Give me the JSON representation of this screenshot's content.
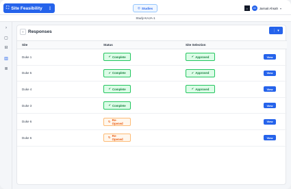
{
  "app": {
    "brand_label": "Site Feasibility",
    "brand_more": "⋮",
    "studies_label": "Studies",
    "user_name": "Jarnait Ahsah",
    "user_initials": "JA",
    "org_logo": "⌂"
  },
  "study_label": "Study-KAJA-1",
  "sidebar": {
    "items": [
      {
        "icon": "chevron-right-icon",
        "glyph": "›"
      },
      {
        "icon": "document-icon",
        "glyph": "▢"
      },
      {
        "icon": "inbox-icon",
        "glyph": "⊟"
      },
      {
        "icon": "chart-icon",
        "glyph": "▥"
      },
      {
        "icon": "file-text-icon",
        "glyph": "≣"
      }
    ]
  },
  "panel": {
    "title": "Responses",
    "back_glyph": "‹",
    "menu_glyph": "⋮",
    "menu_caret": "▾"
  },
  "table": {
    "headers": [
      "Site",
      "Status",
      "Site Selection",
      ""
    ],
    "rows": [
      {
        "site": "Duke 1",
        "status": "Complete",
        "status_type": "complete",
        "selection": "Approved",
        "action": "View"
      },
      {
        "site": "Duke 5",
        "status": "Complete",
        "status_type": "complete",
        "selection": "Approved",
        "action": "View"
      },
      {
        "site": "Duke 4",
        "status": "Complete",
        "status_type": "complete",
        "selection": "Approved",
        "action": "View"
      },
      {
        "site": "Duke 3",
        "status": "Complete",
        "status_type": "complete",
        "selection": "",
        "action": "View"
      },
      {
        "site": "Duke 6",
        "status": "Re-Opened",
        "status_type": "reopened",
        "selection": "",
        "action": "View"
      },
      {
        "site": "Duke 6",
        "status": "Re-Opened",
        "status_type": "reopened",
        "selection": "",
        "action": "View"
      }
    ]
  },
  "colors": {
    "primary": "#2563eb",
    "success": "#22c55e",
    "warning": "#f97316"
  }
}
